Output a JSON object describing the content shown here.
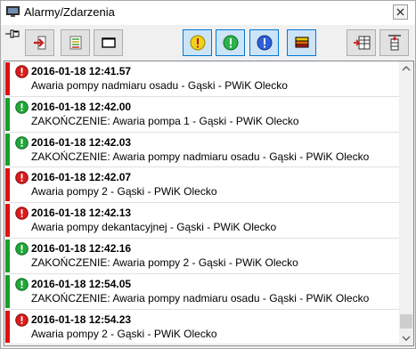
{
  "window": {
    "title": "Alarmy/Zdarzenia"
  },
  "icons": {
    "app": "monitor-icon",
    "close": "close-icon",
    "pin": "pin-icon",
    "alarm": "error-red-circle-icon",
    "end": "success-green-circle-icon"
  },
  "toolbar": {
    "buttons": [
      {
        "name": "exit-button",
        "icon": "exit-door-icon",
        "active": false
      },
      {
        "name": "list-button",
        "icon": "list-icon",
        "active": false
      },
      {
        "name": "blank-button",
        "icon": "window-icon",
        "active": false
      },
      {
        "name": "filter-warning-button",
        "icon": "yellow-warning-icon",
        "active": true
      },
      {
        "name": "filter-ok-button",
        "icon": "green-ok-icon",
        "active": true
      },
      {
        "name": "filter-info-button",
        "icon": "blue-info-icon",
        "active": true
      },
      {
        "name": "filter-flag-button",
        "icon": "flag-icon",
        "active": true
      },
      {
        "name": "column-insert-button",
        "icon": "column-insert-icon",
        "active": false
      },
      {
        "name": "align-button",
        "icon": "vertical-align-icon",
        "active": false
      }
    ]
  },
  "colors": {
    "alarm": "#e01010",
    "end": "#17a02a",
    "active_border": "#0078d7"
  },
  "events": [
    {
      "type": "alarm",
      "timestamp": "2016-01-18 12:41.57",
      "message": "Awaria pompy nadmiaru osadu - Gąski - PWiK Olecko"
    },
    {
      "type": "end",
      "timestamp": "2016-01-18 12:42.00",
      "message": "ZAKOŃCZENIE: Awaria pompa 1 - Gąski - PWiK Olecko"
    },
    {
      "type": "end",
      "timestamp": "2016-01-18 12:42.03",
      "message": "ZAKOŃCZENIE: Awaria pompy nadmiaru osadu - Gąski - PWiK Olecko"
    },
    {
      "type": "alarm",
      "timestamp": "2016-01-18 12:42.07",
      "message": "Awaria pompy 2 - Gąski - PWiK Olecko"
    },
    {
      "type": "alarm",
      "timestamp": "2016-01-18 12:42.13",
      "message": "Awaria pompy dekantacyjnej - Gąski - PWiK Olecko"
    },
    {
      "type": "end",
      "timestamp": "2016-01-18 12:42.16",
      "message": "ZAKOŃCZENIE: Awaria pompy 2 - Gąski - PWiK Olecko"
    },
    {
      "type": "end",
      "timestamp": "2016-01-18 12:54.05",
      "message": "ZAKOŃCZENIE: Awaria pompy nadmiaru osadu - Gąski - PWiK Olecko"
    },
    {
      "type": "alarm",
      "timestamp": "2016-01-18 12:54.23",
      "message": "Awaria pompy 2 - Gąski - PWiK Olecko"
    }
  ]
}
